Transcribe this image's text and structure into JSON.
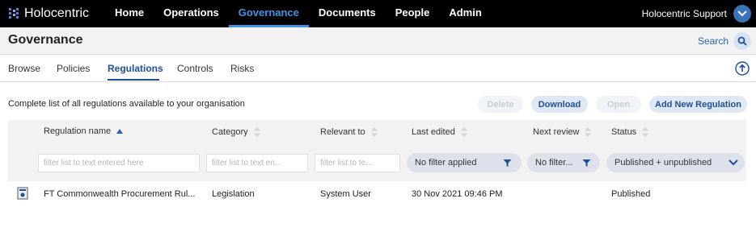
{
  "app": {
    "brand": "Holocentric"
  },
  "nav": {
    "items": [
      "Home",
      "Operations",
      "Governance",
      "Documents",
      "People",
      "Admin"
    ],
    "active": "Governance"
  },
  "user": {
    "name": "Holocentric Support"
  },
  "page": {
    "title": "Governance",
    "search_label": "Search"
  },
  "tabs": [
    "Browse",
    "Policies",
    "Regulations",
    "Controls",
    "Risks"
  ],
  "active_tab": "Regulations",
  "toolbar": {
    "description": "Complete list of all regulations available to your organisation",
    "delete_label": "Delete",
    "download_label": "Download",
    "open_label": "Open",
    "add_label": "Add New Regulation"
  },
  "grid": {
    "columns": [
      "Regulation name",
      "Category",
      "Relevant to",
      "Last edited",
      "Next review",
      "Status"
    ],
    "filters": {
      "name_placeholder": "filter list to text entered here",
      "category_placeholder": "filter list to text en...",
      "relevant_placeholder": "filter list to te...",
      "last_edited": "No filter applied",
      "next_review": "No filter...",
      "status": "Published + unpublished"
    },
    "rows": [
      {
        "name": "FT Commonwealth Procurement Rul...",
        "category": "Legislation",
        "relevant_to": "System User",
        "last_edited": "30 Nov 2021 09:46 PM",
        "next_review": "",
        "status": "Published"
      }
    ]
  },
  "colors": {
    "accent": "#3f95e8",
    "primary_text": "#1e4f9a",
    "topbar": "#000000"
  }
}
